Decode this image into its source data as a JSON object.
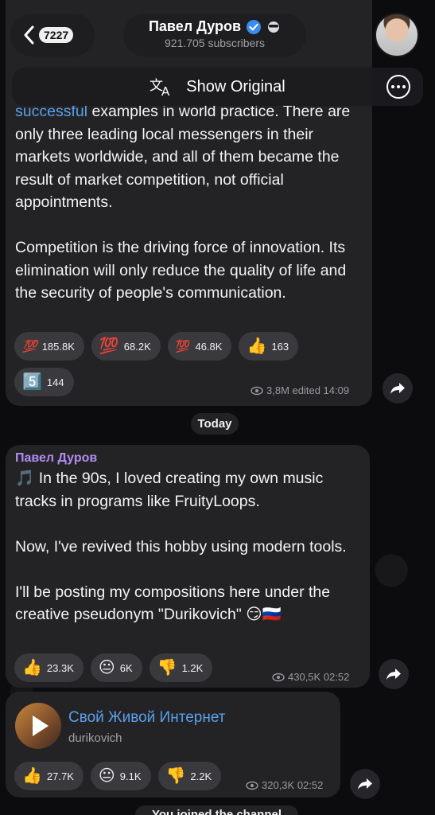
{
  "header": {
    "back_count": "7227",
    "channel_name": "Павел Дуров",
    "subscribers": "921.705 subscribers"
  },
  "translate_bar": {
    "label": "Show Original"
  },
  "post1": {
    "text_link": "successful",
    "text_rest": " examples in world practice. There are only three leading local messengers in their markets worldwide, and all of them became the result of market competition, not official appointments.\n\nCompetition is the driving force of innovation. Its elimination will only reduce the quality of life and the security of people's communication.",
    "reactions": [
      {
        "emoji": "💯",
        "count": "185.8K"
      },
      {
        "emoji": "💯",
        "count": "68.2K"
      },
      {
        "emoji": "💯",
        "count": "46.8K"
      },
      {
        "emoji": "👍",
        "count": "163"
      },
      {
        "emoji": "5️⃣",
        "count": "144"
      }
    ],
    "meta": "3,8M edited 14:09"
  },
  "day_separator": "Today",
  "post2": {
    "author": "Павел Дуров",
    "text": "🎵 In the 90s, I loved creating my own music tracks in programs like FruityLoops.\n\nNow, I've revived this hobby using modern tools.\n\nI'll be posting my compositions here under the creative pseudonym \"Durikovich\" 😏🇷🇺",
    "reactions": [
      {
        "emoji": "👍",
        "count": "23.3K"
      },
      {
        "emoji": "😐",
        "count": "6K"
      },
      {
        "emoji": "👎",
        "count": "1.2K"
      }
    ],
    "meta": "430,5K 02:52"
  },
  "post3": {
    "track_title": "Свой Живой Интернет",
    "track_artist": "durikovich",
    "reactions": [
      {
        "emoji": "👍",
        "count": "27.7K"
      },
      {
        "emoji": "😐",
        "count": "9.1K"
      },
      {
        "emoji": "👎",
        "count": "2.2K"
      }
    ],
    "meta": "320,3K 02:52"
  },
  "footer_notice": "You joined the channel",
  "colors": {
    "accent_link": "#5aa0ea",
    "author": "#b38cf0",
    "verified": "#3b8cf0"
  }
}
